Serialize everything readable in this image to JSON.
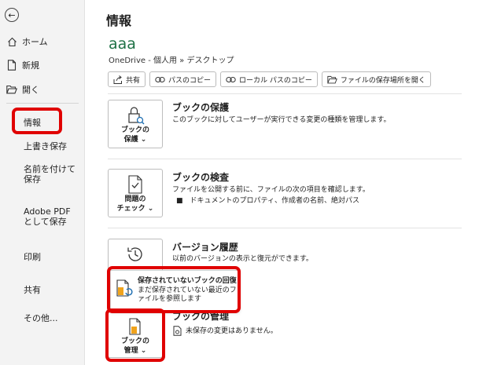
{
  "sidebar": {
    "back_icon": "←",
    "items": [
      {
        "label": "ホーム",
        "icon": "home-icon"
      },
      {
        "label": "新規",
        "icon": "new-document-icon"
      },
      {
        "label": "開く",
        "icon": "folder-open-icon"
      },
      {
        "label": "情報"
      },
      {
        "label": "上書き保存"
      },
      {
        "label": "名前を付けて保存"
      },
      {
        "label": "Adobe PDF として保存"
      },
      {
        "label": "印刷"
      },
      {
        "label": "共有"
      },
      {
        "label": "その他..."
      }
    ]
  },
  "main": {
    "title": "情報",
    "doc_name": "aaa",
    "doc_path": "OneDrive - 個人用 » デスクトップ",
    "buttons": [
      {
        "label": "共有",
        "icon": "share-icon"
      },
      {
        "label": "パスのコピー",
        "icon": "link-icon"
      },
      {
        "label": "ローカル パスのコピー",
        "icon": "link-icon"
      },
      {
        "label": "ファイルの保存場所を開く",
        "icon": "folder-open-icon"
      }
    ],
    "sections": [
      {
        "button_label_1": "ブックの",
        "button_label_2": "保護 ⌄",
        "title": "ブックの保護",
        "desc": "このブックに対してユーザーが実行できる変更の種類を管理します。"
      },
      {
        "button_label_1": "問題の",
        "button_label_2": "チェック ⌄",
        "title": "ブックの検査",
        "desc": "ファイルを公開する前に、ファイルの次の項目を確認します。",
        "bullet": "■　ドキュメントのプロパティ、作成者の名前、絶対パス"
      },
      {
        "title": "バージョン履歴",
        "desc": "以前のバージョンの表示と復元ができます。"
      },
      {
        "button_label_1": "ブックの",
        "button_label_2": "管理 ⌄",
        "title": "ブックの管理",
        "desc": "未保存の変更はありません。"
      }
    ],
    "popup": {
      "title": "保存されていないブックの回復",
      "desc": "まだ保存されていない最近のファイルを参照します"
    }
  },
  "colors": {
    "accent_green": "#1e7145",
    "highlight_red": "#e00000"
  }
}
